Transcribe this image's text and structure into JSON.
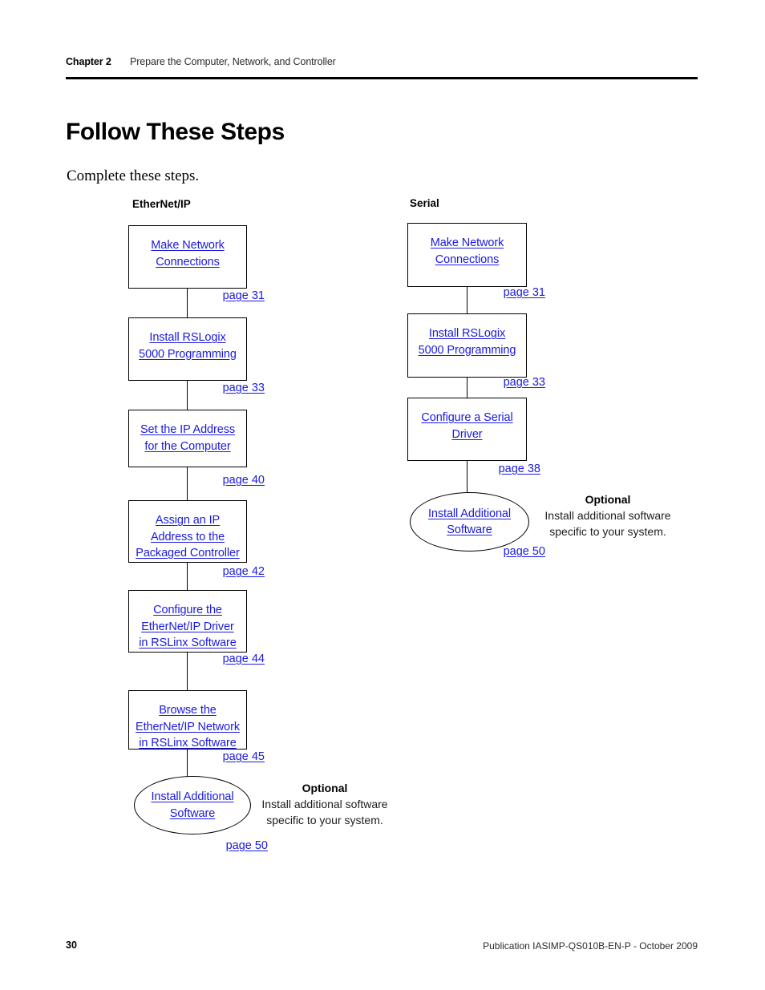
{
  "header": {
    "chapter_label": "Chapter 2",
    "chapter_title": "Prepare the Computer, Network, and Controller"
  },
  "page_title": "Follow These Steps",
  "intro_text": "Complete these steps.",
  "colors": {
    "link": "#1a1ae0",
    "rule": "#000000",
    "text": "#000000"
  },
  "columns": [
    {
      "heading": "EtherNet/IP",
      "steps": [
        {
          "label": "Make Network\nConnections",
          "page_ref": "page 31",
          "shape": "box"
        },
        {
          "label": "Install RSLogix\n5000 Programming",
          "page_ref": "page 33",
          "shape": "box"
        },
        {
          "label": "Set the IP Address\nfor the Computer",
          "page_ref": "page 40",
          "shape": "box"
        },
        {
          "label": "Assign an IP\nAddress to the\nPackaged Controller",
          "page_ref": "page 42",
          "shape": "box"
        },
        {
          "label": "Configure the\nEtherNet/IP Driver\nin RSLinx Software",
          "page_ref": "page 44",
          "shape": "box"
        },
        {
          "label": "Browse the\nEtherNet/IP Network\nin RSLinx Software",
          "page_ref": "page 45",
          "shape": "box"
        },
        {
          "label": "Install Additional\nSoftware",
          "page_ref": "page 50",
          "shape": "oval"
        }
      ],
      "optional": {
        "title": "Optional",
        "body": "Install additional software\nspecific to your system."
      }
    },
    {
      "heading": "Serial",
      "steps": [
        {
          "label": "Make Network\nConnections",
          "page_ref": "page 31",
          "shape": "box"
        },
        {
          "label": "Install RSLogix\n5000 Programming",
          "page_ref": "page 33",
          "shape": "box"
        },
        {
          "label": "Configure a Serial\nDriver",
          "page_ref": "page 38",
          "shape": "box"
        },
        {
          "label": "Install Additional\nSoftware",
          "page_ref": "page 50",
          "shape": "oval"
        }
      ],
      "optional": {
        "title": "Optional",
        "body": "Install additional software\nspecific to your system."
      }
    }
  ],
  "footer": {
    "page_number": "30",
    "publication": "Publication IASIMP-QS010B-EN-P - October 2009"
  }
}
